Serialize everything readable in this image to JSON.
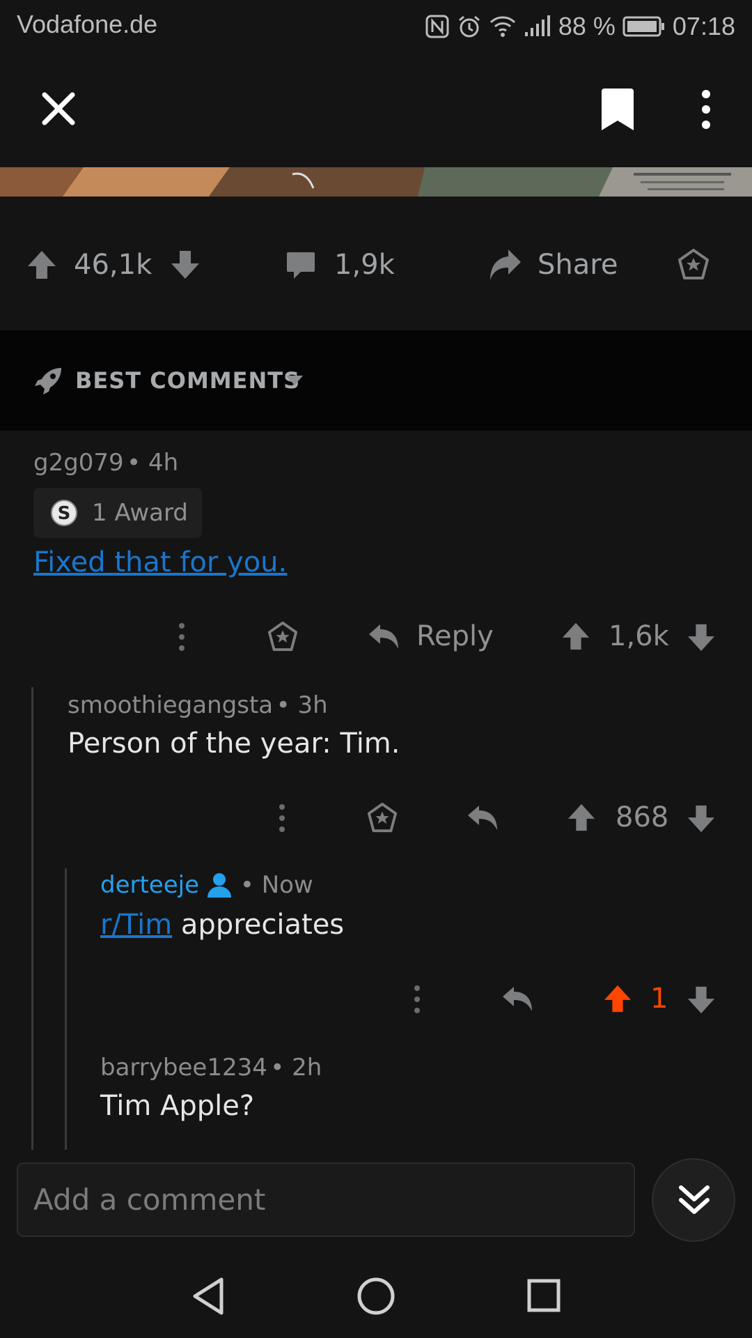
{
  "status_bar": {
    "carrier": "Vodafone.de",
    "battery": "88 %",
    "time": "07:18",
    "icons": [
      "nfc-icon",
      "alarm-icon",
      "wifi-icon",
      "signal-icon",
      "battery-icon"
    ]
  },
  "top_bar": {
    "icons": [
      "close-icon",
      "bookmark-icon",
      "more-vertical-icon"
    ]
  },
  "post_actions": {
    "score": "46,1k",
    "comments": "1,9k",
    "share": "Share"
  },
  "sort": {
    "label": "BEST COMMENTS"
  },
  "comments": [
    {
      "author": "g2g079",
      "age": "4h",
      "award": "1 Award",
      "body": "Fixed that for you.",
      "reply_label": "Reply",
      "score": "1,6k"
    },
    {
      "author": "smoothiegangsta",
      "age": "3h",
      "body": "Person of the year: Tim.",
      "score": "868"
    },
    {
      "author": "derteeje",
      "age": "Now",
      "body_link": "r/Tim",
      "body_rest": " appreciates",
      "score": "1"
    },
    {
      "author": "barrybee1234",
      "age": "2h",
      "body": "Tim Apple?"
    }
  ],
  "composer": {
    "placeholder": "Add a comment"
  },
  "colors": {
    "background": "#141414",
    "upvote_active": "#ff4500",
    "link": "#1a76cc",
    "op_blue": "#24a0ed"
  }
}
